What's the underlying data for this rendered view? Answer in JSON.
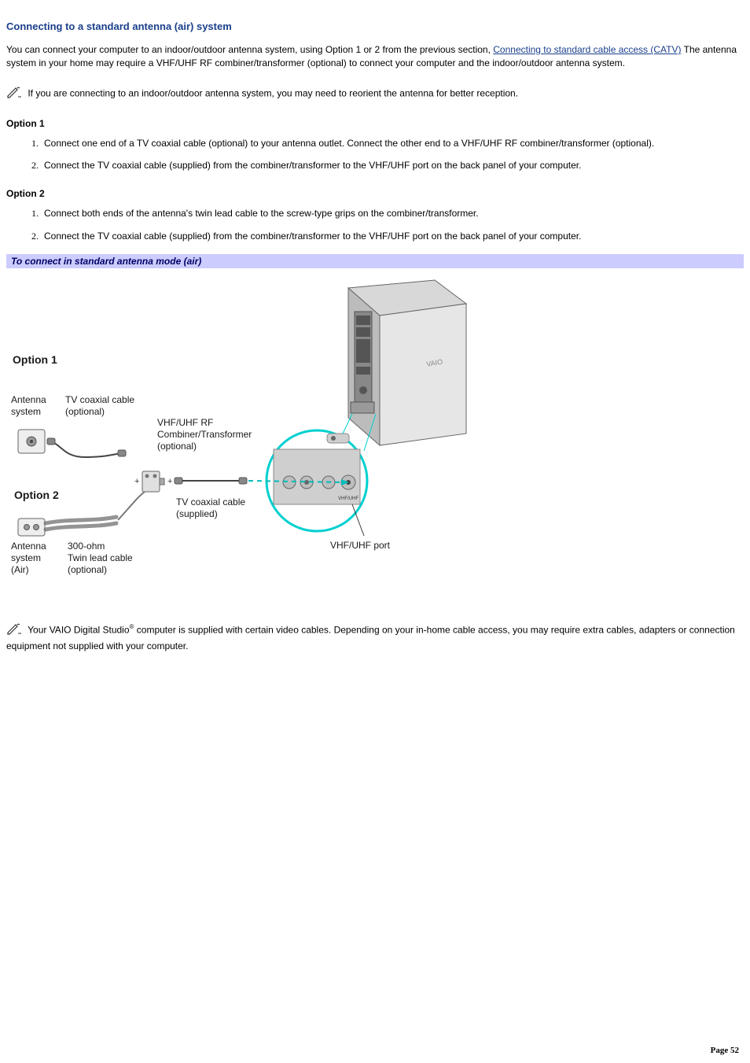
{
  "title": "Connecting to a standard antenna (air) system",
  "intro_part1": "You can connect your computer to an indoor/outdoor antenna system, using Option 1 or 2 from the previous section, ",
  "intro_link": "Connecting to standard cable access (CATV)",
  "intro_part2": " The antenna system in your home may require a VHF/UHF RF combiner/transformer (optional) to connect your computer and the indoor/outdoor antenna system.",
  "note1": " If you are connecting to an indoor/outdoor antenna system, you may need to reorient the antenna for better reception.",
  "option1": {
    "heading": "Option 1",
    "steps": [
      "Connect one end of a TV coaxial cable (optional) to your antenna outlet. Connect the other end to a VHF/UHF RF combiner/transformer (optional).",
      "Connect the TV coaxial cable (supplied) from the combiner/transformer to the VHF/UHF port on the back panel of your computer."
    ]
  },
  "option2": {
    "heading": "Option 2",
    "steps": [
      "Connect both ends of the antenna's twin lead cable to the screw-type grips on the combiner/transformer.",
      "Connect the TV coaxial cable (supplied) from the combiner/transformer to the VHF/UHF port on the back panel of your computer."
    ]
  },
  "callout": "To connect in standard antenna mode (air)",
  "diagram": {
    "opt1": "Option 1",
    "opt2": "Option 2",
    "antenna1": "Antenna\nsystem",
    "antenna2": "Antenna\nsystem\n(Air)",
    "coax_opt": "TV coaxial cable\n(optional)",
    "combiner": "VHF/UHF RF\nCombiner/Transformer\n(optional)",
    "coax_sup": "TV coaxial cable\n(supplied)",
    "twinlead": "300-ohm\nTwin lead cable\n(optional)",
    "port": "VHF/UHF port"
  },
  "note2a": " Your VAIO Digital Studio",
  "note2b": " computer is supplied with certain video cables. Depending on your in-home cable access, you may require extra cables, adapters or connection equipment not supplied with your computer.",
  "reg": "®",
  "page": "Page 52"
}
